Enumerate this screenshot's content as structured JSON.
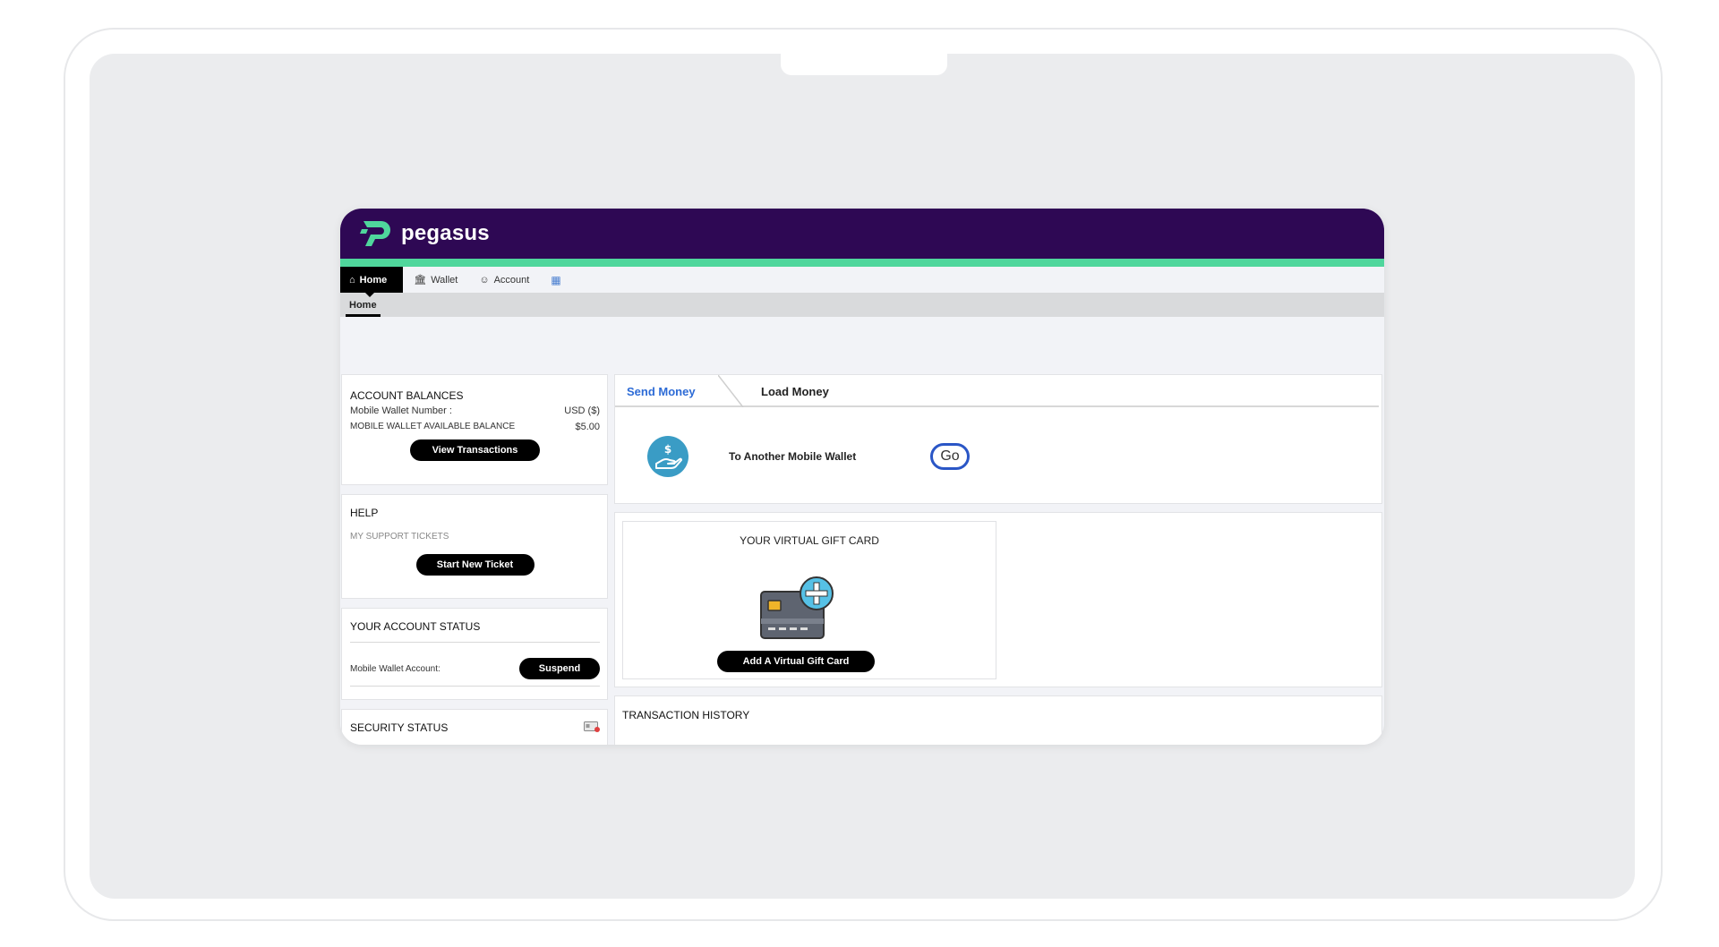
{
  "brand": {
    "name": "pegasus",
    "header_color": "#2e0854",
    "accent_color": "#4fd69c"
  },
  "nav": {
    "items": [
      {
        "label": "Home",
        "icon": "home-icon",
        "active": true
      },
      {
        "label": "Wallet",
        "icon": "bank-icon",
        "active": false
      },
      {
        "label": "Account",
        "icon": "user-circle-icon",
        "active": false
      },
      {
        "label": "",
        "icon": "calendar-icon",
        "active": false
      }
    ],
    "sub": "Home"
  },
  "balances": {
    "title": "ACCOUNT BALANCES",
    "wallet_number_label": "Mobile Wallet Number :",
    "wallet_number_value": "USD ($)",
    "available_label": "MOBILE WALLET AVAILABLE BALANCE",
    "available_value": "$5.00",
    "button": "View Transactions"
  },
  "help": {
    "title": "HELP",
    "subtitle": "MY SUPPORT TICKETS",
    "button": "Start New Ticket"
  },
  "account_status": {
    "title": "YOUR ACCOUNT STATUS",
    "label": "Mobile Wallet Account:",
    "button": "Suspend"
  },
  "security": {
    "title": "SECURITY STATUS",
    "icon": "id-card-icon"
  },
  "transfer": {
    "tabs": [
      {
        "label": "Send Money",
        "active": true
      },
      {
        "label": "Load Money",
        "active": false
      }
    ],
    "option_label": "To Another Mobile Wallet",
    "option_icon": "hand-money-icon",
    "go_button": "Go"
  },
  "gift": {
    "title": "YOUR VIRTUAL GIFT CARD",
    "icon": "credit-card-plus-icon",
    "button": "Add A Virtual Gift Card"
  },
  "history": {
    "title": "TRANSACTION HISTORY"
  }
}
